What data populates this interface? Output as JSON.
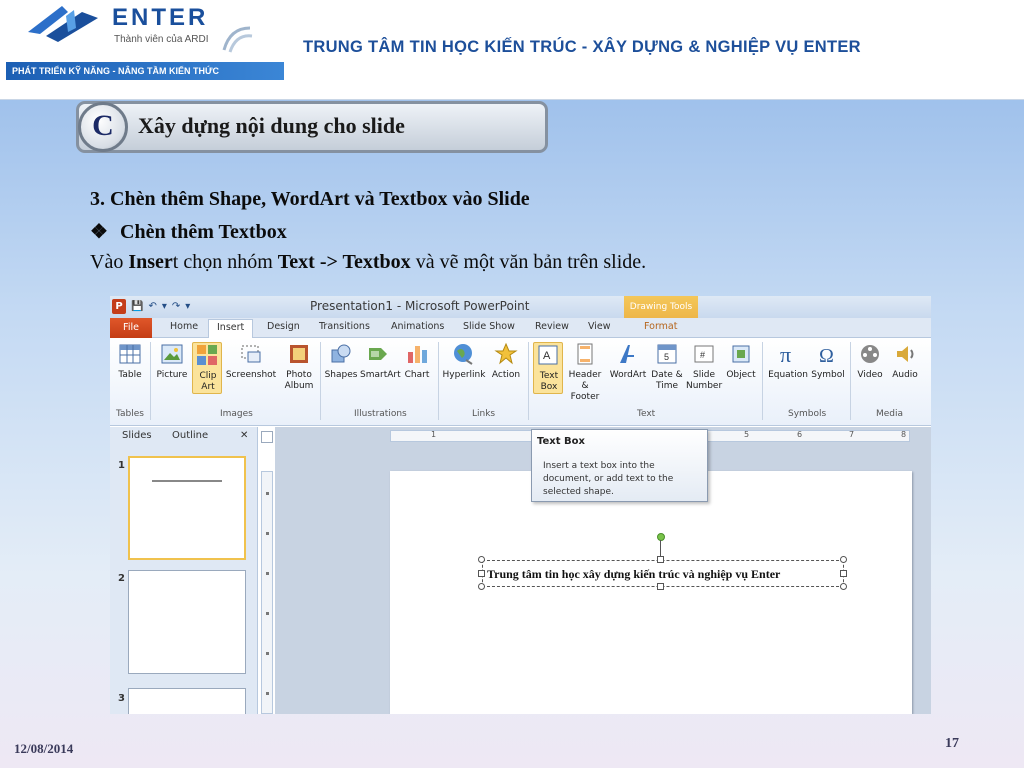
{
  "header": {
    "logo_name": "ENTER",
    "logo_sub": "Thành viên của ARDI",
    "slogan": "PHÁT TRIỂN KỸ NĂNG - NÂNG TẦM KIẾN THỨC",
    "title": "TRUNG TÂM TIN HỌC KIẾN TRÚC - XÂY DỰNG & NGHIỆP VỤ ENTER",
    "brand_color": "#1a4f9c"
  },
  "banner": {
    "letter": "C",
    "text": "Xây dựng nội dung cho slide"
  },
  "content": {
    "heading": "3. Chèn thêm Shape, WordArt và Textbox vào Slide",
    "bullet_glyph": "❖",
    "bullet": "Chèn thêm Textbox",
    "line3": {
      "t1": "Vào ",
      "t2": "Inser",
      "t3": "t chọn nhóm ",
      "t4": "Text -> Textbox",
      "t5": " và vẽ một văn bản trên slide."
    }
  },
  "footer": {
    "date": "12/08/2014",
    "page": "17"
  },
  "ppt": {
    "app_icon": "P",
    "qat": [
      "💾",
      "↶",
      "▾",
      "↷",
      "▾"
    ],
    "window_title": "Presentation1 - Microsoft PowerPoint",
    "drawing_tools": "Drawing Tools",
    "tabs": {
      "file": "File",
      "home": "Home",
      "insert": "Insert",
      "design": "Design",
      "transitions": "Transitions",
      "animations": "Animations",
      "slideshow": "Slide Show",
      "review": "Review",
      "view": "View",
      "format": "Format"
    },
    "ribbon": {
      "table": "Table",
      "picture": "Picture",
      "clipart": "Clip Art",
      "screenshot": "Screenshot",
      "photoalbum": "Photo Album",
      "shapes": "Shapes",
      "smartart": "SmartArt",
      "chart": "Chart",
      "hyperlink": "Hyperlink",
      "action": "Action",
      "textbox": "Text Box",
      "headerfooter": "Header & Footer",
      "wordart": "WordArt",
      "datetime": "Date & Time",
      "slidenumber": "Slide Number",
      "object": "Object",
      "equation": "Equation",
      "symbol": "Symbol",
      "video": "Video",
      "audio": "Audio"
    },
    "groups": {
      "tables": "Tables",
      "images": "Images",
      "illustrations": "Illustrations",
      "links": "Links",
      "text": "Text",
      "symbols": "Symbols",
      "media": "Media"
    },
    "panel": {
      "slides_tab": "Slides",
      "outline_tab": "Outline",
      "close": "✕",
      "thumb_nums": [
        "1",
        "2",
        "3"
      ]
    },
    "ruler_labels": [
      "1",
      "5",
      "6",
      "7",
      "8"
    ],
    "tooltip": {
      "title": "Text Box",
      "body": "Insert a text box into the document, or add text to the selected shape."
    },
    "textbox_text": "Trung tâm tin học xây dựng kiến trúc và nghiệp vụ Enter"
  }
}
